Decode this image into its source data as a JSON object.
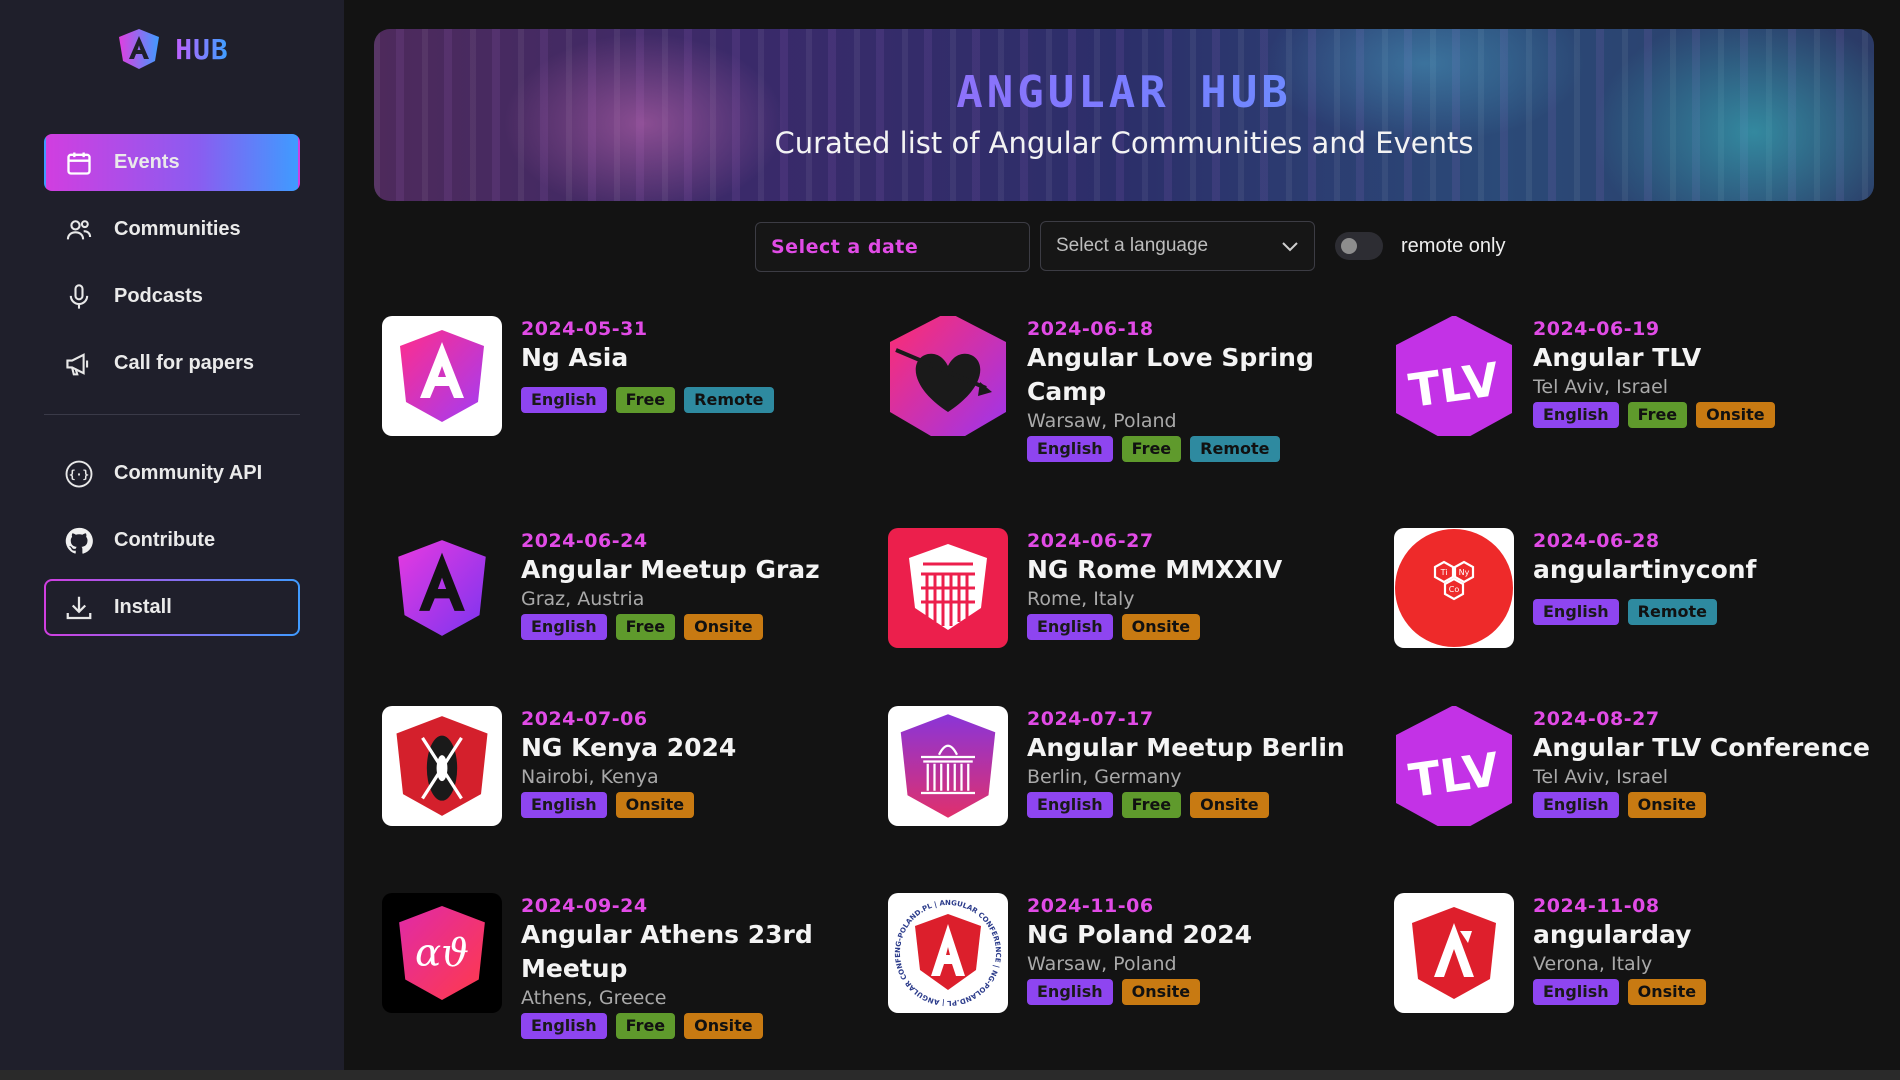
{
  "app": {
    "logo_text": "HUB"
  },
  "nav": {
    "items": [
      {
        "label": "Events",
        "icon": "calendar-icon"
      },
      {
        "label": "Communities",
        "icon": "people-icon"
      },
      {
        "label": "Podcasts",
        "icon": "microphone-icon"
      },
      {
        "label": "Call for papers",
        "icon": "megaphone-icon"
      }
    ],
    "secondary": [
      {
        "label": "Community API",
        "icon": "api-icon"
      },
      {
        "label": "Contribute",
        "icon": "github-icon"
      },
      {
        "label": "Install",
        "icon": "download-icon"
      }
    ]
  },
  "hero": {
    "title": "ANGULAR HUB",
    "subtitle": "Curated list of Angular Communities and Events"
  },
  "filters": {
    "date_placeholder": "Select a date",
    "language_placeholder": "Select a language",
    "remote_label": "remote only",
    "remote_only": false
  },
  "events": [
    {
      "date": "2024-05-31",
      "title": "Ng Asia",
      "location": "",
      "tags": [
        "English",
        "Free",
        "Remote"
      ]
    },
    {
      "date": "2024-06-18",
      "title": "Angular Love Spring Camp",
      "location": "Warsaw, Poland",
      "tags": [
        "English",
        "Free",
        "Remote"
      ]
    },
    {
      "date": "2024-06-19",
      "title": "Angular TLV",
      "location": "Tel Aviv, Israel",
      "tags": [
        "English",
        "Free",
        "Onsite"
      ]
    },
    {
      "date": "2024-06-24",
      "title": "Angular Meetup Graz",
      "location": "Graz, Austria",
      "tags": [
        "English",
        "Free",
        "Onsite"
      ]
    },
    {
      "date": "2024-06-27",
      "title": "NG Rome MMXXIV",
      "location": "Rome, Italy",
      "tags": [
        "English",
        "Onsite"
      ]
    },
    {
      "date": "2024-06-28",
      "title": "angulartinyconf",
      "location": "",
      "tags": [
        "English",
        "Remote"
      ]
    },
    {
      "date": "2024-07-06",
      "title": "NG Kenya 2024",
      "location": "Nairobi, Kenya",
      "tags": [
        "English",
        "Onsite"
      ]
    },
    {
      "date": "2024-07-17",
      "title": "Angular Meetup Berlin",
      "location": "Berlin, Germany",
      "tags": [
        "English",
        "Free",
        "Onsite"
      ]
    },
    {
      "date": "2024-08-27",
      "title": "Angular TLV Conference",
      "location": "Tel Aviv, Israel",
      "tags": [
        "English",
        "Onsite"
      ]
    },
    {
      "date": "2024-09-24",
      "title": "Angular Athens 23rd Meetup",
      "location": "Athens, Greece",
      "tags": [
        "English",
        "Free",
        "Onsite"
      ]
    },
    {
      "date": "2024-11-06",
      "title": "NG Poland 2024",
      "location": "Warsaw, Poland",
      "tags": [
        "English",
        "Onsite"
      ]
    },
    {
      "date": "2024-11-08",
      "title": "angularday",
      "location": "Verona, Italy",
      "tags": [
        "English",
        "Onsite"
      ]
    }
  ],
  "logo_text": {
    "tlv": "TLV",
    "athens": "αϑ",
    "tinyconf": [
      "Ti",
      "Ny",
      "Co"
    ],
    "ngpoland_ring": "NG-POLAND.PL | ANGULAR CONFERENCE | NG-POLAND.PL | ANGULAR CONFERENCE"
  },
  "colors": {
    "accent_pink": "#e14be6",
    "accent_blue": "#3f9bff",
    "tag_english": "#8e45f0",
    "tag_free": "#5f9a2c",
    "tag_remote": "#2e8aa0",
    "tag_onsite": "#c87a12"
  }
}
